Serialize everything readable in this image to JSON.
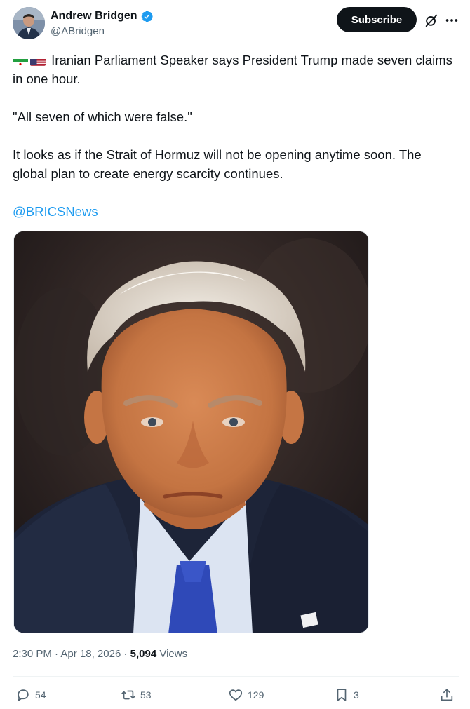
{
  "author": {
    "display_name": "Andrew Bridgen",
    "handle": "@ABridgen",
    "verified_icon": "verified-badge-icon",
    "avatar_icon": "avatar"
  },
  "header": {
    "subscribe_label": "Subscribe",
    "grok_icon": "grok-icon",
    "more_icon": "more-icon"
  },
  "post": {
    "flags": [
      "iran-flag-icon",
      "us-flag-icon"
    ],
    "paragraph1": "Iranian Parliament Speaker says President Trump made seven claims in one hour.",
    "paragraph2": "\"All seven of which were false.\"",
    "paragraph3": "It looks as if the Strait of Hormuz will not be opening anytime soon. The global plan to create energy scarcity continues.",
    "mention": "@BRICSNews",
    "image": "photo-portrait"
  },
  "meta": {
    "time": "2:30 PM",
    "separator": " · ",
    "date": "Apr 18, 2026",
    "views_count": "5,094",
    "views_label": "Views"
  },
  "actions": {
    "replies": "54",
    "reposts": "53",
    "likes": "129",
    "bookmarks": "3"
  },
  "colors": {
    "text": "#0f1419",
    "secondary": "#536471",
    "link": "#1d9bf0",
    "button_dark": "#0f1419"
  }
}
